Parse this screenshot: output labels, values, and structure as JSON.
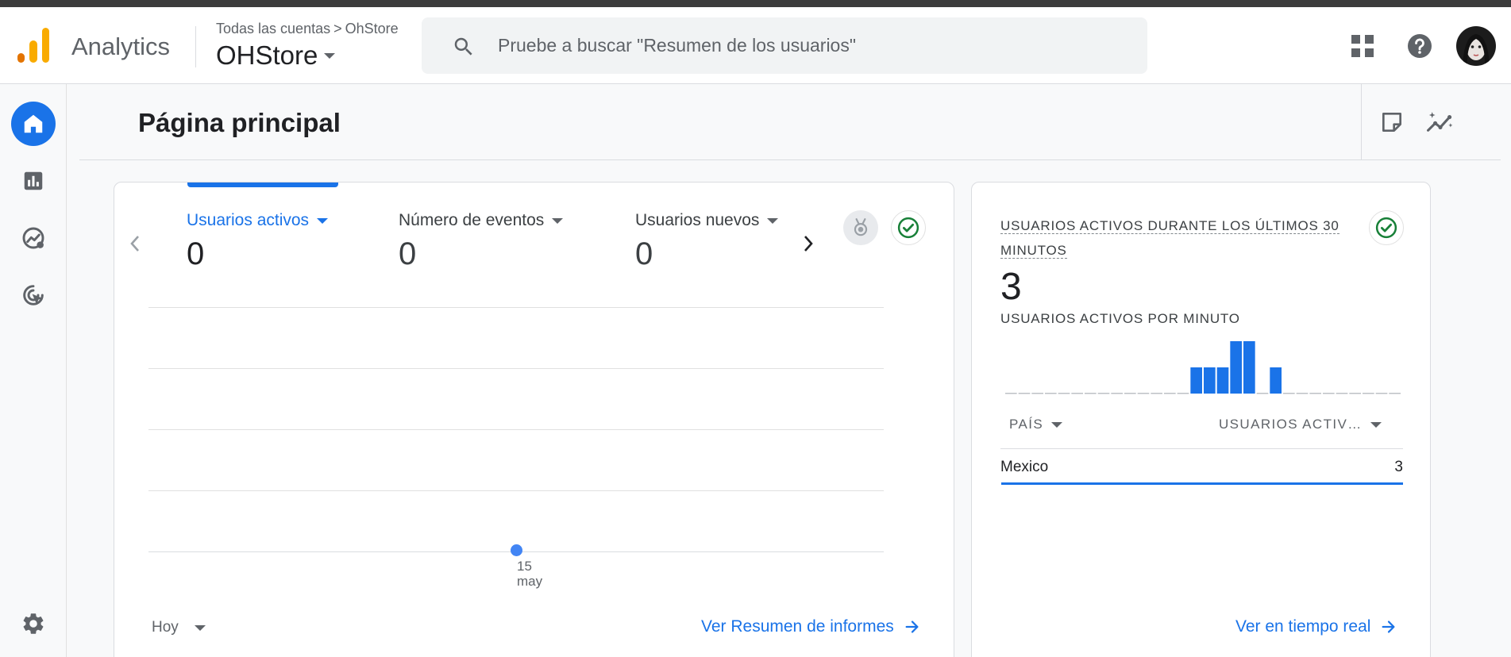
{
  "header": {
    "app_name": "Analytics",
    "breadcrumb_account": "Todas las cuentas",
    "breadcrumb_separator": ">",
    "breadcrumb_property": "OhStore",
    "property_name": "OHStore",
    "search_placeholder": "Pruebe a buscar \"Resumen de los usuarios\""
  },
  "leftnav": {
    "items": [
      "home-icon",
      "reports-icon",
      "explore-icon",
      "advertising-icon"
    ],
    "admin_icon": "settings-gear-icon",
    "active_item": "home"
  },
  "page": {
    "title": "Página principal"
  },
  "overview": {
    "metrics": [
      {
        "label": "Usuarios activos",
        "value": "0",
        "active": true
      },
      {
        "label": "Número de eventos",
        "value": "0",
        "active": false
      },
      {
        "label": "Usuarios nuevos",
        "value": "0",
        "active": false
      }
    ],
    "range": "Hoy",
    "link": "Ver Resumen de informes"
  },
  "chart_data": {
    "type": "line",
    "x": [
      "15 may"
    ],
    "series": [
      {
        "values": [
          0
        ]
      }
    ],
    "x_tick_day": "15",
    "x_tick_month": "may",
    "grid": true
  },
  "realtime": {
    "title": "USUARIOS ACTIVOS DURANTE LOS ÚLTIMOS 30 MINUTOS",
    "value": "3",
    "per_minute_label": "USUARIOS ACTIVOS POR MINUTO",
    "per_minute_values": [
      0,
      0,
      0,
      0,
      0,
      0,
      0,
      0,
      0,
      0,
      0,
      0,
      0,
      0,
      1,
      1,
      1,
      2,
      2,
      0,
      1,
      0,
      0,
      0,
      0,
      0,
      0,
      0,
      0,
      0
    ],
    "table": {
      "col_country": "PAÍS",
      "col_users": "USUARIOS ACTIV…",
      "rows": [
        {
          "country": "Mexico",
          "value": "3"
        }
      ]
    },
    "link": "Ver en tiempo real"
  },
  "colors": {
    "accent": "#1a73e8",
    "bar": "#1a73e8",
    "success": "#188038",
    "logo_orange": "#f9ab00",
    "logo_dark_orange": "#e37400"
  }
}
